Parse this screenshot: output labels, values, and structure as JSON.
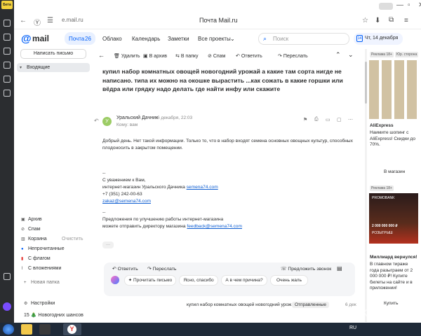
{
  "browser": {
    "yandex_badge": "Бета",
    "address": "e.mail.ru",
    "window_title": "Почта Mail.ru"
  },
  "header": {
    "logo_text": "mail",
    "nav": [
      {
        "label": "Почта",
        "count": "26"
      },
      {
        "label": "Облако"
      },
      {
        "label": "Календарь"
      },
      {
        "label": "Заметки"
      },
      {
        "label": "Все проекты"
      }
    ],
    "search_placeholder": "Поиск",
    "date_day": "14",
    "date_label": "Чт, 14 декабря"
  },
  "sidebar": {
    "compose_label": "Написать письмо",
    "inbox_label": "Входящие",
    "folders": [
      {
        "label": "Архив",
        "icon": "archive-icon"
      },
      {
        "label": "Спам",
        "icon": "spam-icon"
      },
      {
        "label": "Корзина",
        "icon": "trash-icon",
        "action": "Очистить"
      },
      {
        "label": "Непрочитанные",
        "icon": "unread-dot"
      },
      {
        "label": "С флагом",
        "icon": "flag-icon"
      },
      {
        "label": "С вложениями",
        "icon": "attachment-icon"
      }
    ],
    "new_folder": "Новая папка",
    "settings": "Настройки",
    "promo": "15 🎄 Новогодних шансов"
  },
  "toolbar": {
    "delete": "Удалить",
    "archive": "В архив",
    "to_folder": "В папку",
    "spam": "Спам",
    "reply": "Ответить",
    "forward": "Переслать"
  },
  "message": {
    "subject": "купил набор комнатных овощей новогодний урожай а какие там сорта нигде не написано. типа их можно на окошке вырастить ...как сожать в какие горшки или вёдра или грядку надо делать где найти инфу или скажите",
    "avatar_letter": "У",
    "sender": "Уральский Дачник",
    "date": "6 декабря, 22:03",
    "to": "Кому: вам",
    "body_1": "Добрый день. Нет такой информации. Только то, что в набор входят семена основных овощных культур, способных",
    "body_2": "плодоносить в закрытом помещении.",
    "sig_dash": "--",
    "sig_regards": "С уважением к Вам,",
    "sig_shop_prefix": "интернет-магазин Уральского Дачника ",
    "sig_shop_link": "semena74.com",
    "sig_phone": "+7 (351) 242-00-63",
    "sig_email": "zakaz@semena74.com",
    "sig_dash2": "--",
    "sig_suggest": "Предложения по улучшению работы интернет-магазина",
    "sig_director_prefix": "можете отправить директору магазина ",
    "sig_director_link": "feedback@semena74.com",
    "more": "···"
  },
  "quick_reply": {
    "reply": "Ответить",
    "forward": "Переслать",
    "call": "Предложить звонок",
    "options": [
      "Прочитать письмо",
      "Ясно, спасибо",
      "А в чем причина?",
      "Очень жаль"
    ]
  },
  "bottom_bar": {
    "subject": "купил набор комнатных овощей новогодний урож...",
    "folder": "Отправленные",
    "date": "6 дек"
  },
  "ads": {
    "badge1": "Реклама 18+",
    "badge_small": "Юр. сторона",
    "ali_title": "AliExpress",
    "ali_text": "Наимите шопинг с AliExpress! Скидки до 70%.",
    "ali_cta": "В магазин",
    "badge2": "Реклама 18+",
    "brand": "PROMOBANK",
    "banner_amount": "2 000 000 000 ₽",
    "banner_text": "РОЗЫГРЫШ",
    "millionaire_title": "Миллиард вернулся!",
    "millionaire_text": "В главном тираже года разыграем от 2 000 000 ₽! Купите билеты на сайте и в приложении!",
    "cta2": "Купить"
  },
  "taskbar": {
    "lang": "RU",
    "watermark": "OTZOVIK"
  },
  "colors": {
    "accent": "#005ff9",
    "sender_avatar": "#9ccc65",
    "link": "#0d5dd1"
  }
}
